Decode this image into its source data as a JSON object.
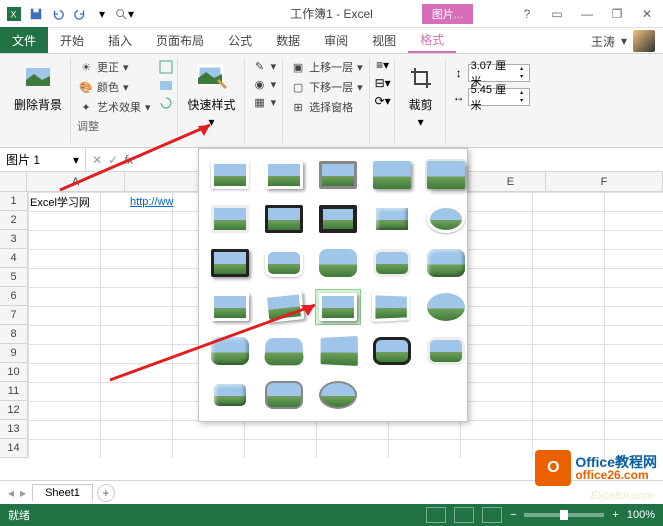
{
  "window": {
    "title": "工作簿1 - Excel",
    "contextual_tab": "图片...",
    "user_name": "王涛"
  },
  "qat_icons": [
    "excel-icon",
    "save-icon",
    "undo-icon",
    "redo-icon",
    "touch-mode-icon",
    "find-icon"
  ],
  "win_controls": [
    "help-icon",
    "ribbon-options-icon",
    "minimize-icon",
    "restore-icon",
    "close-icon"
  ],
  "tabs": {
    "file": "文件",
    "items": [
      "开始",
      "插入",
      "页面布局",
      "公式",
      "数据",
      "审阅",
      "视图"
    ],
    "active": "格式"
  },
  "ribbon": {
    "remove_bg": "删除背景",
    "corrections": "更正",
    "color": "颜色",
    "artistic": "艺术效果",
    "adjust_label": "调整",
    "quick_styles": "快速样式",
    "bring_forward": "上移一层",
    "send_backward": "下移一层",
    "selection_pane": "选择窗格",
    "crop": "裁剪",
    "height_label": "3.07 厘米",
    "width_label": "5.45 厘米"
  },
  "name_box": "图片 1",
  "cells": {
    "A1": "Excel学习网",
    "B1": "http://ww"
  },
  "columns": [
    "A",
    "E",
    "F"
  ],
  "row_count": 14,
  "sheet": {
    "active": "Sheet1"
  },
  "statusbar": {
    "ready": "就绪",
    "zoom": "100%"
  },
  "watermark": {
    "line1": "Office教程网",
    "line2": "office26.com",
    "url": "Excelcn.com"
  }
}
